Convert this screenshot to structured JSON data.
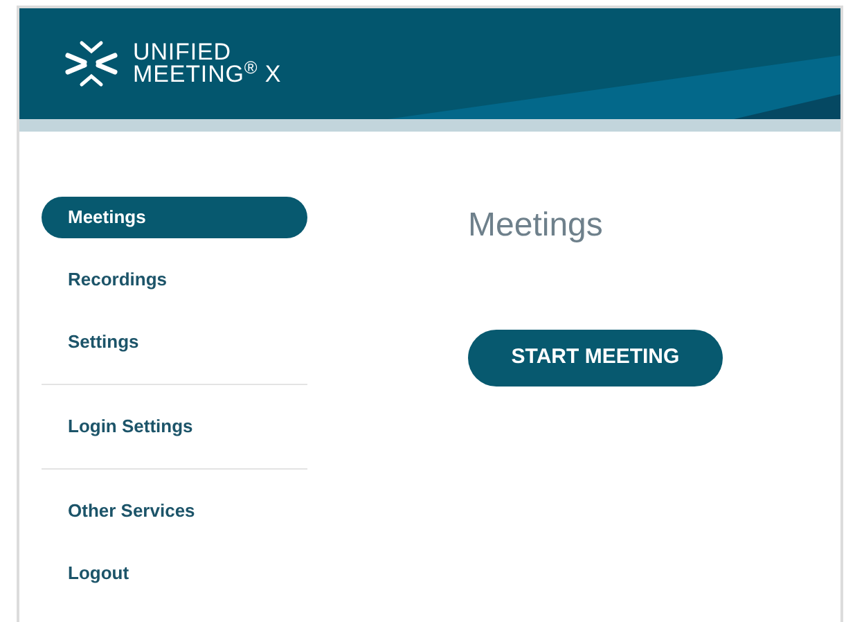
{
  "header": {
    "logo_line_1": "UNIFIED",
    "logo_line_2": "MEETING$^{®}$ X"
  },
  "sidebar": {
    "groups": [
      {
        "items": [
          {
            "label": "Meetings",
            "selected": true
          },
          {
            "label": "Recordings",
            "selected": false
          },
          {
            "label": "Settings",
            "selected": false
          }
        ]
      },
      {
        "items": [
          {
            "label": "Login Settings",
            "selected": false
          }
        ]
      },
      {
        "items": [
          {
            "label": "Other Services",
            "selected": false
          },
          {
            "label": "Logout",
            "selected": false
          }
        ]
      }
    ]
  },
  "main": {
    "title": "Meetings",
    "button": "START MEETING"
  }
}
